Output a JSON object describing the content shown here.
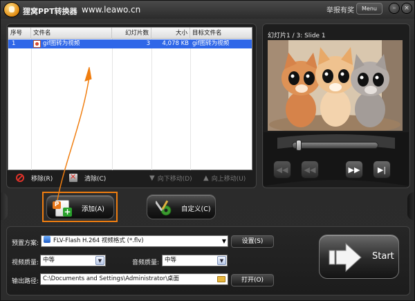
{
  "title_bar": {
    "app_title": "狸窝PPT转换器",
    "url": "www.leawo.cn",
    "report_link": "举报有奖",
    "menu_button": "Menu",
    "minimize": "–",
    "close": "×"
  },
  "file_list": {
    "columns": [
      "序号",
      "文件名",
      "幻灯片数",
      "大小",
      "目标文件名"
    ],
    "rows": [
      {
        "index": "1",
        "name": "gif图转为视频",
        "slides": "3",
        "size": "4,078 KB",
        "target": "gif图转为视频",
        "selected": true
      }
    ]
  },
  "list_toolbar": {
    "remove": "移除(R)",
    "clear": "清除(C)",
    "move_down": "向下移动(D)",
    "move_up": "向上移动(U)"
  },
  "actions": {
    "add": "添加(A)",
    "customize": "自定义(C)"
  },
  "preview": {
    "slide_label": "幻灯片1 / 3: Slide 1",
    "progress": 0.03
  },
  "settings": {
    "preset_label": "预置方案:",
    "preset_value": "FLV-Flash H.264 视频格式 (*.flv)",
    "settings_button": "设置(S)",
    "video_quality_label": "视频质量:",
    "video_quality_value": "中等",
    "audio_quality_label": "音频质量:",
    "audio_quality_value": "中等",
    "output_label": "输出路径:",
    "output_value": "C:\\Documents and Settings\\Administrator\\桌面",
    "open_button": "打开(O)"
  },
  "start": {
    "label": "Start"
  },
  "colors": {
    "accent_orange": "#f07e10",
    "selection_blue": "#2f67e8",
    "remove_red": "#e0332a"
  },
  "icons": [
    "app-logo-icon",
    "ppt-file-icon",
    "remove-icon",
    "clear-icon",
    "arrow-down-icon",
    "arrow-up-icon",
    "add-document-icon",
    "tools-icon",
    "flv-icon",
    "folder-icon",
    "start-arrow-icon"
  ]
}
